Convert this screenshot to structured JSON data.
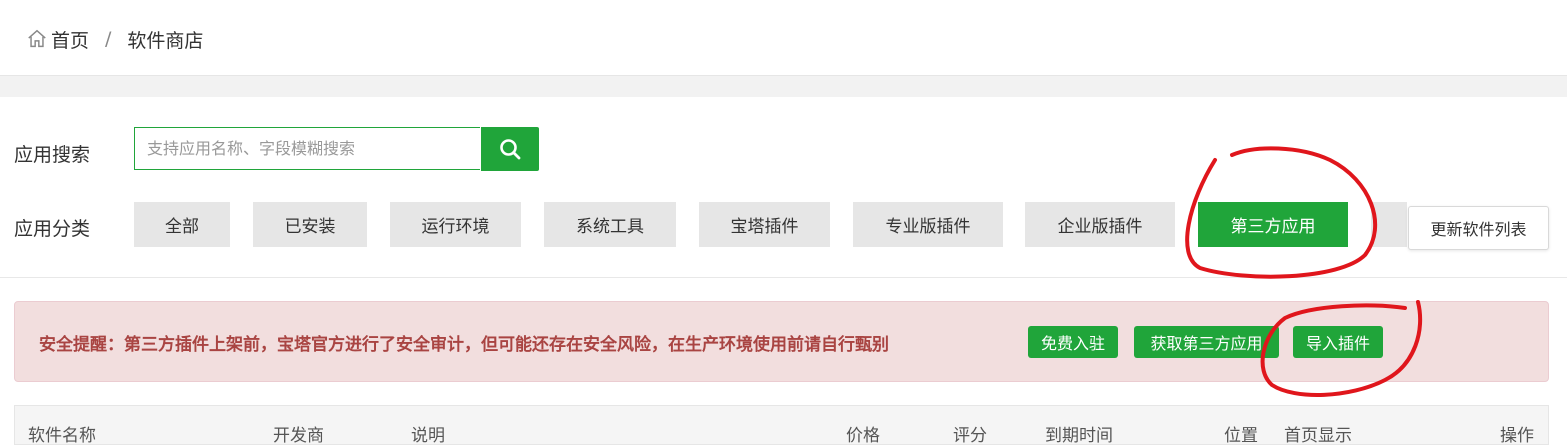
{
  "breadcrumb": {
    "home": "首页",
    "separator": "/",
    "current": "软件商店",
    "home_icon": "home-icon"
  },
  "search": {
    "label": "应用搜索",
    "placeholder": "支持应用名称、字段模糊搜索",
    "value": "",
    "button_icon": "search-icon"
  },
  "categories": {
    "label": "应用分类",
    "items": [
      {
        "label": "全部"
      },
      {
        "label": "已安装"
      },
      {
        "label": "运行环境"
      },
      {
        "label": "系统工具"
      },
      {
        "label": "宝塔插件"
      },
      {
        "label": "专业版插件"
      },
      {
        "label": "企业版插件"
      },
      {
        "label": "第三方应用",
        "active": true
      }
    ],
    "refresh_label": "更新软件列表"
  },
  "alert": {
    "text": "安全提醒：第三方插件上架前，宝塔官方进行了安全审计，但可能还存在安全风险，在生产环境使用前请自行甄别",
    "buttons": [
      "免费入驻",
      "获取第三方应用",
      "导入插件"
    ]
  },
  "table": {
    "columns": [
      "软件名称",
      "开发商",
      "说明",
      "价格",
      "评分",
      "到期时间",
      "位置",
      "首页显示",
      "操作"
    ]
  },
  "colors": {
    "accent": "#20a53a",
    "alert_bg": "#f2dede",
    "alert_text": "#a94442",
    "annotation": "#e0161c"
  }
}
